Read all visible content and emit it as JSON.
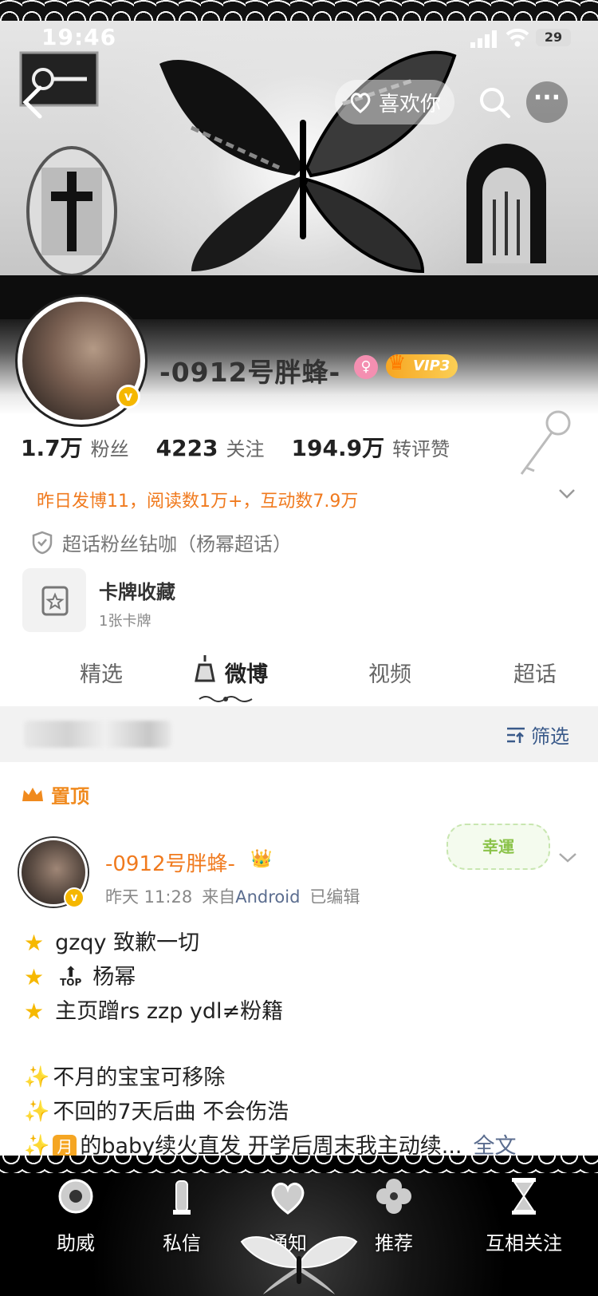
{
  "status_bar": {
    "time": "19:46",
    "battery": "29"
  },
  "header": {
    "like_label": "喜欢你"
  },
  "profile": {
    "username": "-0912号胖蜂-",
    "gender_symbol": "♀",
    "vip_label": "VIP3",
    "stats": [
      {
        "value": "1.7万",
        "label": "粉丝"
      },
      {
        "value": "4223",
        "label": "关注"
      },
      {
        "value": "194.9万",
        "label": "转评赞"
      }
    ],
    "daily_summary": "昨日发博11，阅读数1万+，互动数7.9万",
    "super_topic": "超话粉丝钻咖（杨幂超话）",
    "card_collection": {
      "title": "卡牌收藏",
      "subtitle": "1张卡牌"
    }
  },
  "tabs": [
    {
      "label": "精选",
      "active": false
    },
    {
      "label": "微博",
      "active": true
    },
    {
      "label": "视频",
      "active": false
    },
    {
      "label": "超话",
      "active": false
    }
  ],
  "filter": {
    "label": "筛选"
  },
  "pinned": {
    "badge": "置顶",
    "author": "-0912号胖蜂-",
    "time": "昨天 11:28",
    "source_prefix": "来自",
    "source": "Android",
    "edited": "已编辑",
    "sticker": "幸運",
    "lines": [
      {
        "icon": "star",
        "text": "gzqy 致歉一切"
      },
      {
        "icon": "star",
        "text": "杨幂",
        "top_arrow": "TOP"
      },
      {
        "icon": "star",
        "text": "主页蹭rs zzp ydl≠粉籍"
      },
      {
        "icon": "none",
        "text": ""
      },
      {
        "icon": "sparkle",
        "text": "不月的宝宝可移除"
      },
      {
        "icon": "sparkle",
        "text": "不回的7天后曲 不会伤浩"
      },
      {
        "icon": "sparkle",
        "badge": "月",
        "text": "的baby续火直发 开学后周末我主动续...",
        "more": "全文"
      }
    ]
  },
  "bottom_nav": [
    {
      "label": "助威"
    },
    {
      "label": "私信"
    },
    {
      "label": "通知"
    },
    {
      "label": "推荐"
    },
    {
      "label": "互相关注"
    }
  ]
}
